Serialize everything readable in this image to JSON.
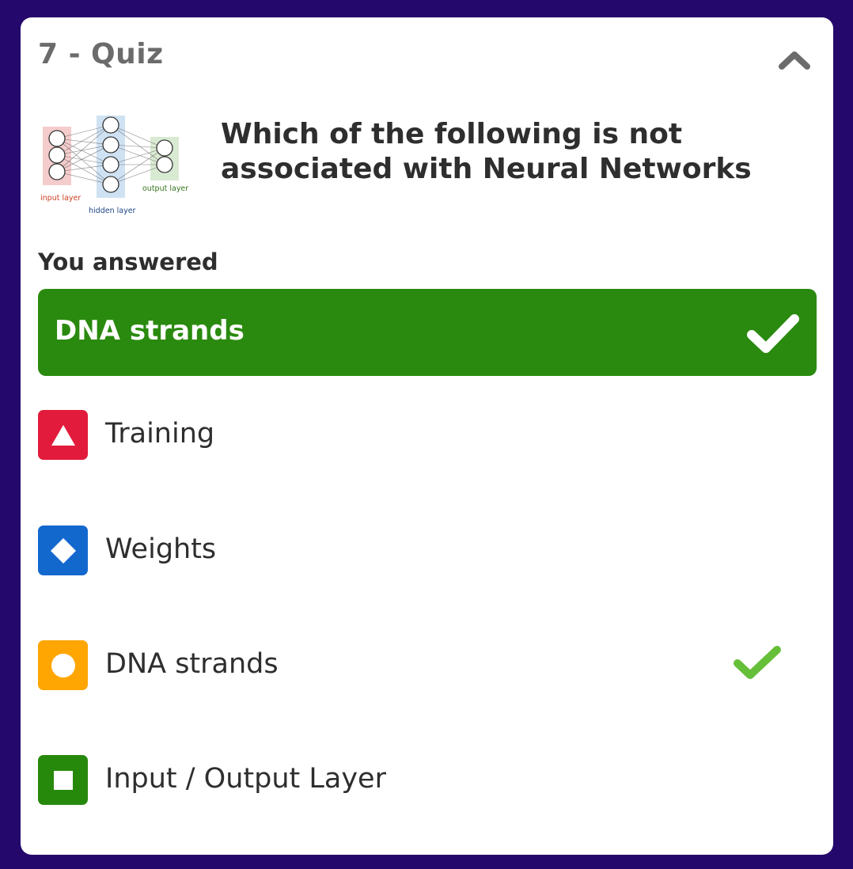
{
  "card": {
    "title": "7 - Quiz",
    "collapse_icon": "chevron-up-icon"
  },
  "question": {
    "text": "Which of the following is not associated with Neural Networks",
    "image": {
      "input_label": "input layer",
      "hidden_label": "hidden layer",
      "output_label": "output layer"
    }
  },
  "answer": {
    "label": "You answered",
    "value": "DNA strands",
    "status": "correct",
    "color": "#2a8a0f"
  },
  "options": [
    {
      "label": "Training",
      "shape": "triangle-icon",
      "color": "#e21b3c",
      "correct": false
    },
    {
      "label": "Weights",
      "shape": "diamond-icon",
      "color": "#1368ce",
      "correct": false
    },
    {
      "label": "DNA strands",
      "shape": "circle-icon",
      "color": "#ffa602",
      "correct": true
    },
    {
      "label": "Input / Output Layer",
      "shape": "square-icon",
      "color": "#26890c",
      "correct": false
    }
  ],
  "colors": {
    "background": "#24086b",
    "check": "#66bf39"
  }
}
